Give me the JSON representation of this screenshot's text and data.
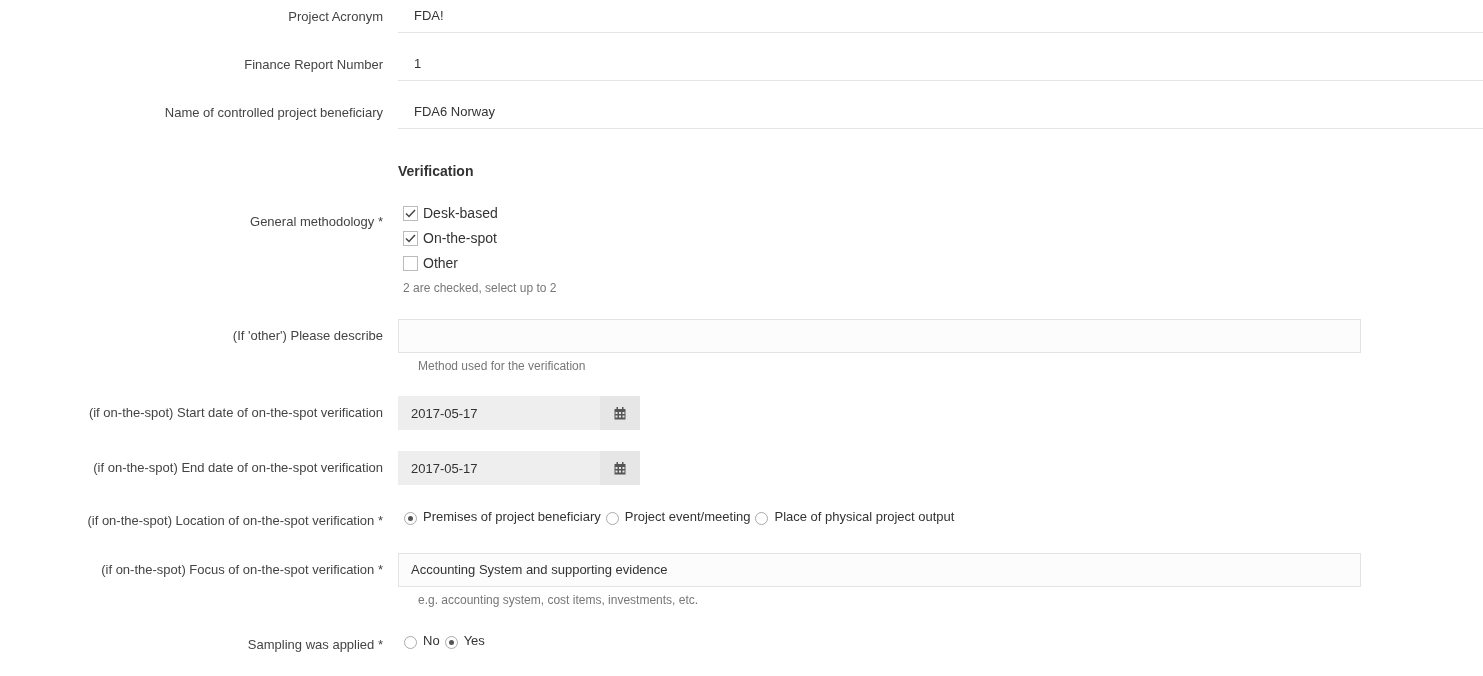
{
  "fields": [
    {
      "kind": "static",
      "label": "Project Acronym",
      "value": "FDA!"
    },
    {
      "kind": "static",
      "label": "Finance Report Number",
      "value": "1"
    },
    {
      "kind": "static",
      "label": "Name of controlled project beneficiary",
      "value": "FDA6 Norway"
    },
    {
      "kind": "heading",
      "text": "Verification"
    },
    {
      "kind": "checkboxes",
      "label": "General methodology *",
      "options": [
        {
          "label": "Desk-based",
          "checked": true
        },
        {
          "label": "On-the-spot",
          "checked": true
        },
        {
          "label": "Other",
          "checked": false
        }
      ],
      "hint": "2 are checked, select up to 2"
    },
    {
      "kind": "text_input",
      "label": "(If 'other') Please describe",
      "hint": "Method used for the verification"
    },
    {
      "kind": "date",
      "label": "(if on-the-spot) Start date of on-the-spot verification",
      "value": "2017-05-17"
    },
    {
      "kind": "date",
      "label": "(if on-the-spot) End date of on-the-spot verification",
      "value": "2017-05-17"
    },
    {
      "kind": "radios",
      "label": "(if on-the-spot) Location of on-the-spot verification *",
      "options": [
        {
          "label": "Premises of project beneficiary",
          "selected": true
        },
        {
          "label": "Project event/meeting",
          "selected": false
        },
        {
          "label": "Place of physical project output",
          "selected": false
        }
      ]
    },
    {
      "kind": "text_input",
      "label": "(if on-the-spot) Focus of on-the-spot verification *",
      "value": "Accounting System and supporting evidence",
      "hint": "e.g. accounting system, cost items, investments, etc."
    },
    {
      "kind": "radios",
      "label": "Sampling was applied *",
      "options": [
        {
          "label": "No",
          "selected": false
        },
        {
          "label": "Yes",
          "selected": true
        }
      ]
    }
  ]
}
